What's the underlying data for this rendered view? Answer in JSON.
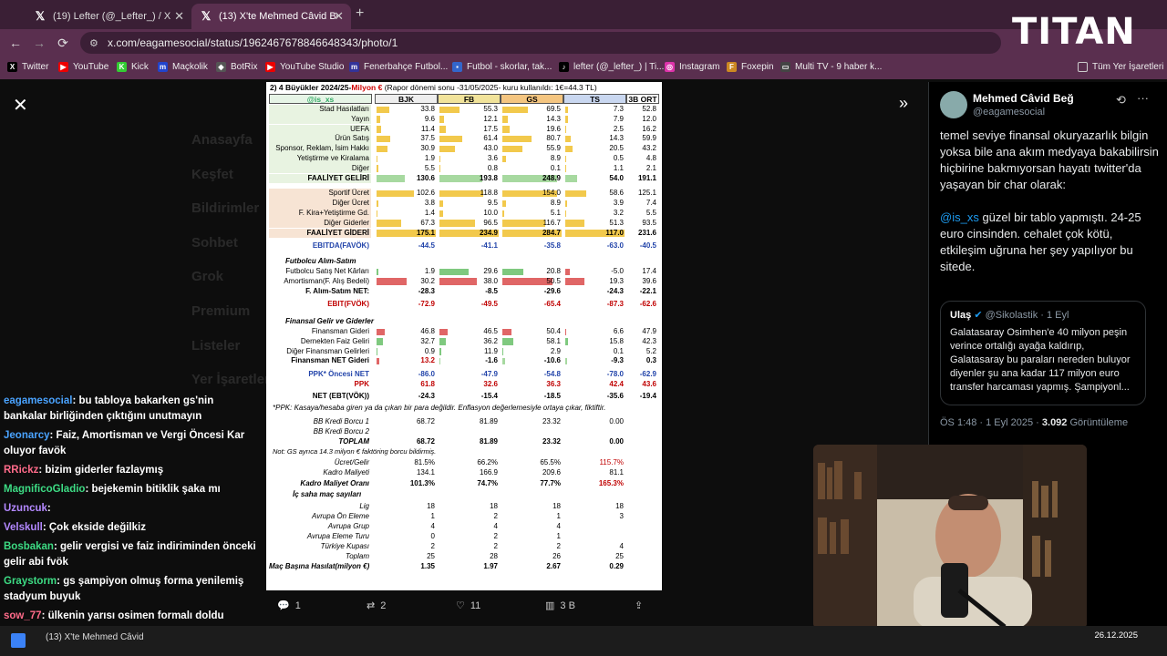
{
  "browser": {
    "tabs": [
      {
        "label": "(19) Lefter (@_Lefter_) / X"
      },
      {
        "label": "(13) X'te Mehmed Câvid Beğ: \"t"
      }
    ],
    "url": "x.com/eagamesocial/status/1962467678846648343/photo/1",
    "bookmarks": [
      "Twitter",
      "YouTube",
      "Kick",
      "Maçkolik",
      "BotRix",
      "YouTube Studio",
      "Fenerbahçe Futbol...",
      "Futbol - skorlar, tak...",
      "lefter (@_lefter_) | Ti...",
      "Instagram",
      "Foxepin",
      "Multi TV - 9 haber k...",
      "Tüm Yer İşaretleri"
    ]
  },
  "overlay": {
    "brand": "TITAN"
  },
  "background_nav": [
    "Anasayfa",
    "Keşfet",
    "Bildirimler",
    "Sohbet",
    "Grok",
    "Premium",
    "Listeler",
    "Yer İşaretleri"
  ],
  "table": {
    "title_prefix": "2) 4 Büyükler 2024/25-",
    "title_red": "Milyon €",
    "title_suffix": " (Rapor dönemi sonu -31/05/2025- kuru kullanıldı: 1€=44.3 TL)",
    "handle": "@is_xs",
    "columns": [
      "BJK",
      "FB",
      "GS",
      "TS",
      "3B ORT"
    ],
    "colors": {
      "bjk": "#000000",
      "fb": "#1f3a93",
      "gs": "#c00000",
      "ts": "#7a1f3d",
      "bar_pos": "#f2c94c",
      "bar_green": "#7fc97f",
      "bar_red": "#e06666"
    },
    "rows": [
      {
        "label": "Stad Hasılatları",
        "vals": [
          "33.8",
          "55.3",
          "69.5",
          "7.3",
          "52.8"
        ]
      },
      {
        "label": "Yayın",
        "vals": [
          "9.6",
          "12.1",
          "14.3",
          "7.9",
          "12.0"
        ]
      },
      {
        "label": "UEFA",
        "vals": [
          "11.4",
          "17.5",
          "19.6",
          "2.5",
          "16.2"
        ]
      },
      {
        "label": "Ürün Satış",
        "vals": [
          "37.5",
          "61.4",
          "80.7",
          "14.3",
          "59.9"
        ]
      },
      {
        "label": "Sponsor, Reklam, İsim Hakkı",
        "vals": [
          "30.9",
          "43.0",
          "55.9",
          "20.5",
          "43.2"
        ]
      },
      {
        "label": "Yetiştirme ve Kiralama",
        "vals": [
          "1.9",
          "3.6",
          "8.9",
          "0.5",
          "4.8"
        ]
      },
      {
        "label": "Diğer",
        "vals": [
          "5.5",
          "0.8",
          "0.1",
          "1.1",
          "2.1"
        ]
      },
      {
        "label": "FAALİYET GELİRİ",
        "vals": [
          "130.6",
          "193.8",
          "248.9",
          "54.0",
          "191.1"
        ]
      },
      {
        "label": "Sportif Ücret",
        "vals": [
          "102.6",
          "118.8",
          "154.0",
          "58.6",
          "125.1"
        ]
      },
      {
        "label": "Diğer Ücret",
        "vals": [
          "3.8",
          "9.5",
          "8.9",
          "3.9",
          "7.4"
        ]
      },
      {
        "label": "F. Kira+Yetiştirme Gd.",
        "vals": [
          "1.4",
          "10.0",
          "5.1",
          "3.2",
          "5.5"
        ]
      },
      {
        "label": "Diğer Giderler",
        "vals": [
          "67.3",
          "96.5",
          "116.7",
          "51.3",
          "93.5"
        ]
      },
      {
        "label": "FAALİYET GİDERİ",
        "vals": [
          "175.1",
          "234.9",
          "284.7",
          "117.0",
          "231.6"
        ]
      },
      {
        "label": "EBITDA(FAVÖK)",
        "vals": [
          "-44.5",
          "-41.1",
          "-35.8",
          "-63.0",
          "-40.5"
        ]
      },
      {
        "label": "Futbolcu Alım-Satım",
        "vals": [
          "",
          "",
          "",
          "",
          ""
        ]
      },
      {
        "label": "Futbolcu Satış Net Kârları",
        "vals": [
          "1.9",
          "29.6",
          "20.8",
          "-5.0",
          "17.4"
        ]
      },
      {
        "label": "Amortisman(F. Alış Bedeli)",
        "vals": [
          "30.2",
          "38.0",
          "50.5",
          "19.3",
          "39.6"
        ]
      },
      {
        "label": "F. Alım-Satım NET:",
        "vals": [
          "-28.3",
          "-8.5",
          "-29.6",
          "-24.3",
          "-22.1"
        ]
      },
      {
        "label": "EBIT(FVÖK)",
        "vals": [
          "-72.9",
          "-49.5",
          "-65.4",
          "-87.3",
          "-62.6"
        ]
      },
      {
        "label": "Finansal Gelir ve Giderler",
        "vals": [
          "",
          "",
          "",
          "",
          ""
        ]
      },
      {
        "label": "Finansman Gideri",
        "vals": [
          "46.8",
          "46.5",
          "50.4",
          "6.6",
          "47.9"
        ]
      },
      {
        "label": "Dernekten Faiz Geliri",
        "vals": [
          "32.7",
          "36.2",
          "58.1",
          "15.8",
          "42.3"
        ]
      },
      {
        "label": "Diğer Finansman Gelirleri",
        "vals": [
          "0.9",
          "11.9",
          "2.9",
          "0.1",
          "5.2"
        ]
      },
      {
        "label": "Finansman NET Gideri",
        "vals": [
          "13.2",
          "-1.6",
          "-10.6",
          "-9.3",
          "0.3"
        ]
      },
      {
        "label": "PPK* Öncesi NET",
        "vals": [
          "-86.0",
          "-47.9",
          "-54.8",
          "-78.0",
          "-62.9"
        ]
      },
      {
        "label": "PPK",
        "vals": [
          "61.8",
          "32.6",
          "36.3",
          "42.4",
          "43.6"
        ]
      },
      {
        "label": "NET (EBT(VÖK))",
        "vals": [
          "-24.3",
          "-15.4",
          "-18.5",
          "-35.6",
          "-19.4"
        ]
      }
    ],
    "ppk_note": "*PPK: Kasaya/hesaba giren ya da çıkan bir para değildir. Enflasyon değerlemesiyle ortaya çıkar, fiktiftir.",
    "debt_rows": [
      {
        "label": "BB Kredi Borcu 1",
        "vals": [
          "68.72",
          "81.89",
          "23.32",
          "0.00"
        ]
      },
      {
        "label": "BB Kredi Borcu 2",
        "vals": [
          "",
          "",
          "",
          ""
        ]
      },
      {
        "label": "TOPLAM",
        "vals": [
          "68.72",
          "81.89",
          "23.32",
          "0.00"
        ]
      }
    ],
    "gs_note": "Not: GS ayrıca 14.3 milyon € faktöring borcu bildirmiş.",
    "ratio_rows": [
      {
        "label": "Ücret/Gelir",
        "vals": [
          "81.5%",
          "66.2%",
          "65.5%",
          "115.7%"
        ]
      },
      {
        "label": "Kadro Maliyeti",
        "vals": [
          "134.1",
          "166.9",
          "209.6",
          "81.1"
        ]
      },
      {
        "label": "Kadro Maliyet Oranı",
        "vals": [
          "101.3%",
          "74.7%",
          "77.7%",
          "165.3%"
        ]
      }
    ],
    "home_title": "İç saha maç sayıları",
    "home_rows": [
      {
        "label": "Lig",
        "vals": [
          "18",
          "18",
          "18",
          "18"
        ]
      },
      {
        "label": "Avrupa Ön Eleme",
        "vals": [
          "1",
          "2",
          "1",
          "3"
        ]
      },
      {
        "label": "Avrupa Grup",
        "vals": [
          "4",
          "4",
          "4",
          ""
        ]
      },
      {
        "label": "Avrupa Eleme Turu",
        "vals": [
          "0",
          "2",
          "1",
          ""
        ]
      },
      {
        "label": "Türkiye Kupası",
        "vals": [
          "2",
          "2",
          "2",
          "4"
        ]
      },
      {
        "label": "Toplam",
        "vals": [
          "25",
          "28",
          "26",
          "25"
        ]
      },
      {
        "label": "Maç Başına Hasılat(milyon €)",
        "vals": [
          "1.35",
          "1.97",
          "2.67",
          "0.29"
        ]
      }
    ]
  },
  "photo_actions": {
    "reply": "1",
    "retweet": "2",
    "like": "11",
    "views": "3 B"
  },
  "tweet": {
    "name": "Mehmed Câvid Beğ",
    "handle": "@eagamesocial",
    "text1": "temel seviye finansal okuryazarlık bilgin yoksa bile ana akım medyaya bakabilirsin hiçbirine bakmıyorsan hayatı twitter'da yaşayan bir char olarak:",
    "mention": "@is_xs",
    "text2": " güzel bir tablo yapmıştı. 24-25 euro cinsinden. cehalet çok kötü, etkileşim uğruna her şey yapılıyor bu sitede.",
    "quote": {
      "name": "Ulaş",
      "handle": "@Sikolastik · 1 Eyl",
      "text": "Galatasaray Osimhen'e 40 milyon peşin verince ortalığı ayağa kaldırıp, Galatasaray bu paraları nereden buluyor diyenler şu ana kadar 117 milyon euro transfer harcaması yapmış. Şampiyonl..."
    },
    "time": "ÖS 1:48 · 1 Eyl 2025 · ",
    "views": "3.092",
    "views_label": " Görüntüleme"
  },
  "chat": [
    {
      "user": "eagamesocial",
      "color": "#4aa3ff",
      "text": ": bu tabloya bakarken gs'nin bankalar birliğinden çıktığını unutmayın"
    },
    {
      "user": "Jeonarcy",
      "color": "#4aa3ff",
      "text": ": Faiz, Amortisman ve Vergi Öncesi Kar oluyor favök"
    },
    {
      "user": "RRickz",
      "color": "#ff6b8a",
      "text": ": bizim giderler fazlaymış"
    },
    {
      "user": "MagnificoGladio",
      "color": "#3ddc84",
      "text": ": bejekemin bitiklik şaka mı"
    },
    {
      "user": "Uzuncuk",
      "color": "#b388ff",
      "text": ": "
    },
    {
      "user": "Velskull",
      "color": "#b388ff",
      "text": ": Çok ekside değilkiz"
    },
    {
      "user": "Bosbakan",
      "color": "#3ddc84",
      "text": ": gelir vergisi ve faiz indiriminden önceki gelir abi fvök"
    },
    {
      "user": "Graystorm",
      "color": "#3ddc84",
      "text": ": gs şampiyon olmuş forma yenilemiş stadyum buyuk"
    },
    {
      "user": "sow_77",
      "color": "#ff6b8a",
      "text": ": ülkenin yarısı osimen formalı doldu"
    }
  ],
  "chat_tail": "normal",
  "taskbar": {
    "app": "(13) X'te Mehmed Câvid",
    "date": "26.12.2025"
  }
}
